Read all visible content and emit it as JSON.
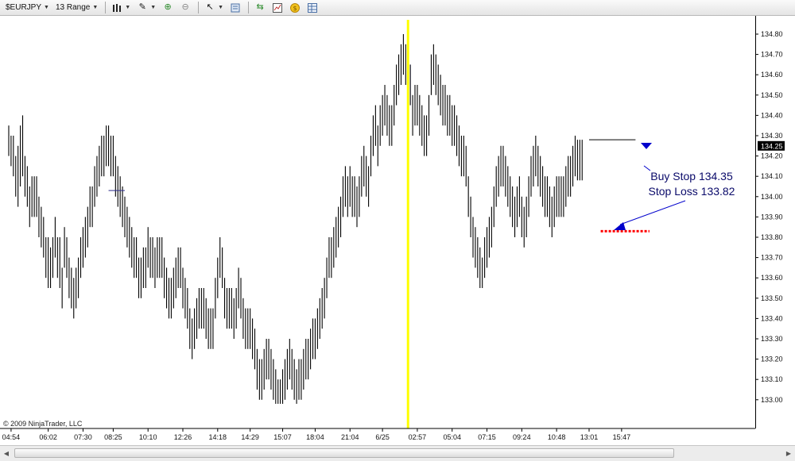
{
  "toolbar": {
    "instrument": "$EURJPY",
    "interval": "13 Range"
  },
  "copyright": "© 2009 NinjaTrader, LLC",
  "colors": {
    "bars": "#000000",
    "marker_line": "#ffff00",
    "stop_loss": "#ff0000",
    "arrows": "#0000cc",
    "annotation_text": "#0a0a6a",
    "current_price_bg": "#000000"
  },
  "chart_data": {
    "type": "ohlc",
    "title": "",
    "xlabel": "",
    "ylabel": "",
    "ylim": [
      132.95,
      134.85
    ],
    "y_ticks": [
      "134.80",
      "134.70",
      "134.60",
      "134.50",
      "134.40",
      "134.30",
      "134.20",
      "134.10",
      "134.00",
      "133.90",
      "133.80",
      "133.70",
      "133.60",
      "133.50",
      "133.40",
      "133.30",
      "133.20",
      "133.10",
      "133.00"
    ],
    "x_ticks": [
      "04:54",
      "06:02",
      "07:30",
      "08:25",
      "10:10",
      "12:26",
      "14:18",
      "14:29",
      "15:07",
      "18:04",
      "21:04",
      "6/25",
      "02:57",
      "05:04",
      "07:15",
      "09:24",
      "10:48",
      "13:01",
      "15:47"
    ],
    "x_tick_bar_index": [
      1,
      17,
      32,
      45,
      60,
      75,
      90,
      104,
      118,
      132,
      147,
      161,
      176,
      191,
      206,
      221,
      236,
      250,
      264
    ],
    "bar_count": 270,
    "highs": [
      134.35,
      134.3,
      134.3,
      134.2,
      134.25,
      134.35,
      134.4,
      134.2,
      134.15,
      134.05,
      134.1,
      134.1,
      134.1,
      134.0,
      133.95,
      133.9,
      133.8,
      133.8,
      133.75,
      133.8,
      133.9,
      133.8,
      133.8,
      133.65,
      133.85,
      133.8,
      133.7,
      133.65,
      133.6,
      133.65,
      133.7,
      133.8,
      133.85,
      133.9,
      133.95,
      134.05,
      134.05,
      134.15,
      134.2,
      134.25,
      134.3,
      134.3,
      134.35,
      134.35,
      134.3,
      134.3,
      134.2,
      134.15,
      134.1,
      134.05,
      134.0,
      133.95,
      133.9,
      133.85,
      133.8,
      133.8,
      133.7,
      133.7,
      133.75,
      133.75,
      133.85,
      133.8,
      133.8,
      133.75,
      133.8,
      133.8,
      133.8,
      133.7,
      133.65,
      133.6,
      133.6,
      133.65,
      133.7,
      133.75,
      133.75,
      133.65,
      133.6,
      133.55,
      133.45,
      133.4,
      133.45,
      133.5,
      133.55,
      133.55,
      133.55,
      133.5,
      133.45,
      133.45,
      133.45,
      133.6,
      133.7,
      133.8,
      133.75,
      133.6,
      133.55,
      133.55,
      133.55,
      133.5,
      133.55,
      133.65,
      133.6,
      133.5,
      133.45,
      133.45,
      133.45,
      133.4,
      133.35,
      133.25,
      133.2,
      133.2,
      133.25,
      133.3,
      133.3,
      133.25,
      133.2,
      133.15,
      133.1,
      133.1,
      133.15,
      133.2,
      133.25,
      133.3,
      133.25,
      133.2,
      133.15,
      133.2,
      133.2,
      133.25,
      133.3,
      133.3,
      133.35,
      133.4,
      133.4,
      133.45,
      133.5,
      133.55,
      133.6,
      133.7,
      133.8,
      133.8,
      133.85,
      133.9,
      133.95,
      134.0,
      134.1,
      134.15,
      134.1,
      134.15,
      134.1,
      134.1,
      134.05,
      134.1,
      134.2,
      134.25,
      134.2,
      134.15,
      134.3,
      134.4,
      134.45,
      134.35,
      134.45,
      134.5,
      134.55,
      134.5,
      134.45,
      134.45,
      134.55,
      134.65,
      134.7,
      134.75,
      134.8,
      134.75,
      134.7,
      134.65,
      134.5,
      134.55,
      134.55,
      134.5,
      134.45,
      134.4,
      134.4,
      134.5,
      134.7,
      134.75,
      134.7,
      134.65,
      134.6,
      134.55,
      134.55,
      134.5,
      134.5,
      134.45,
      134.45,
      134.4,
      134.35,
      134.3,
      134.3,
      134.25,
      134.1,
      134.0,
      133.9,
      133.85,
      133.8,
      133.75,
      133.7,
      133.8,
      133.85,
      133.9,
      133.95,
      134.05,
      134.15,
      134.2,
      134.25,
      134.25,
      134.2,
      134.15,
      134.1,
      134.05,
      134.0,
      134.05,
      134.1,
      134.0,
      133.95,
      134.0,
      134.1,
      134.2,
      134.25,
      134.3,
      134.25,
      134.2,
      134.15,
      134.1,
      134.1,
      134.05,
      134.0,
      134.05,
      134.1,
      134.1,
      134.1,
      134.1,
      134.15,
      134.2,
      134.2,
      134.25,
      134.3,
      134.28,
      134.28,
      134.28
    ],
    "lows": [
      134.2,
      134.15,
      134.1,
      134.0,
      133.95,
      134.05,
      134.1,
      134.0,
      133.95,
      133.85,
      133.9,
      133.9,
      133.9,
      133.8,
      133.75,
      133.7,
      133.6,
      133.55,
      133.55,
      133.6,
      133.7,
      133.6,
      133.55,
      133.45,
      133.65,
      133.6,
      133.5,
      133.45,
      133.4,
      133.45,
      133.5,
      133.6,
      133.65,
      133.7,
      133.75,
      133.85,
      133.85,
      133.95,
      134.0,
      134.05,
      134.1,
      134.1,
      134.15,
      134.15,
      134.1,
      134.1,
      134.0,
      133.95,
      133.9,
      133.85,
      133.8,
      133.75,
      133.7,
      133.65,
      133.6,
      133.6,
      133.5,
      133.5,
      133.55,
      133.55,
      133.65,
      133.6,
      133.6,
      133.55,
      133.6,
      133.6,
      133.6,
      133.5,
      133.45,
      133.4,
      133.4,
      133.45,
      133.5,
      133.55,
      133.55,
      133.45,
      133.4,
      133.35,
      133.25,
      133.2,
      133.25,
      133.3,
      133.35,
      133.35,
      133.35,
      133.3,
      133.25,
      133.25,
      133.25,
      133.4,
      133.5,
      133.6,
      133.55,
      133.4,
      133.35,
      133.35,
      133.35,
      133.3,
      133.35,
      133.45,
      133.4,
      133.3,
      133.25,
      133.25,
      133.25,
      133.2,
      133.15,
      133.05,
      133.0,
      133.0,
      133.05,
      133.1,
      133.1,
      133.05,
      133.0,
      132.98,
      132.98,
      132.98,
      132.98,
      133.0,
      133.05,
      133.1,
      133.05,
      133.0,
      132.98,
      133.0,
      133.0,
      133.05,
      133.1,
      133.1,
      133.15,
      133.2,
      133.2,
      133.25,
      133.3,
      133.35,
      133.4,
      133.5,
      133.6,
      133.6,
      133.65,
      133.7,
      133.75,
      133.8,
      133.9,
      133.95,
      133.9,
      133.95,
      133.9,
      133.9,
      133.85,
      133.9,
      134.0,
      134.05,
      134.0,
      133.95,
      134.1,
      134.2,
      134.25,
      134.15,
      134.25,
      134.3,
      134.35,
      134.3,
      134.25,
      134.25,
      134.35,
      134.45,
      134.5,
      134.55,
      134.6,
      134.55,
      134.5,
      134.45,
      134.3,
      134.35,
      134.35,
      134.3,
      134.25,
      134.2,
      134.2,
      134.3,
      134.5,
      134.55,
      134.5,
      134.45,
      134.4,
      134.35,
      134.35,
      134.3,
      134.3,
      134.25,
      134.25,
      134.2,
      134.15,
      134.1,
      134.1,
      134.05,
      133.9,
      133.8,
      133.7,
      133.65,
      133.6,
      133.55,
      133.55,
      133.6,
      133.65,
      133.7,
      133.75,
      133.85,
      133.95,
      134.0,
      134.05,
      134.05,
      134.0,
      133.95,
      133.9,
      133.85,
      133.8,
      133.85,
      133.9,
      133.8,
      133.75,
      133.8,
      133.9,
      134.0,
      134.05,
      134.1,
      134.05,
      134.0,
      133.95,
      133.9,
      133.9,
      133.85,
      133.8,
      133.85,
      133.9,
      133.9,
      133.9,
      133.9,
      133.95,
      134.0,
      134.0,
      134.05,
      134.1,
      134.08,
      134.08,
      134.08
    ],
    "resistance_line": {
      "price": 134.28,
      "from_bar": 250,
      "to_bar": 270
    },
    "stop_loss_line": {
      "price": 133.83,
      "from_bar": 255,
      "to_bar": 276
    },
    "small_hline": {
      "price": 134.03,
      "from_bar": 43,
      "to_bar": 50
    },
    "marker_bar": 172,
    "current_price": "134.25",
    "annotations": [
      "Buy Stop 134.35",
      "Stop Loss 133.82"
    ]
  }
}
